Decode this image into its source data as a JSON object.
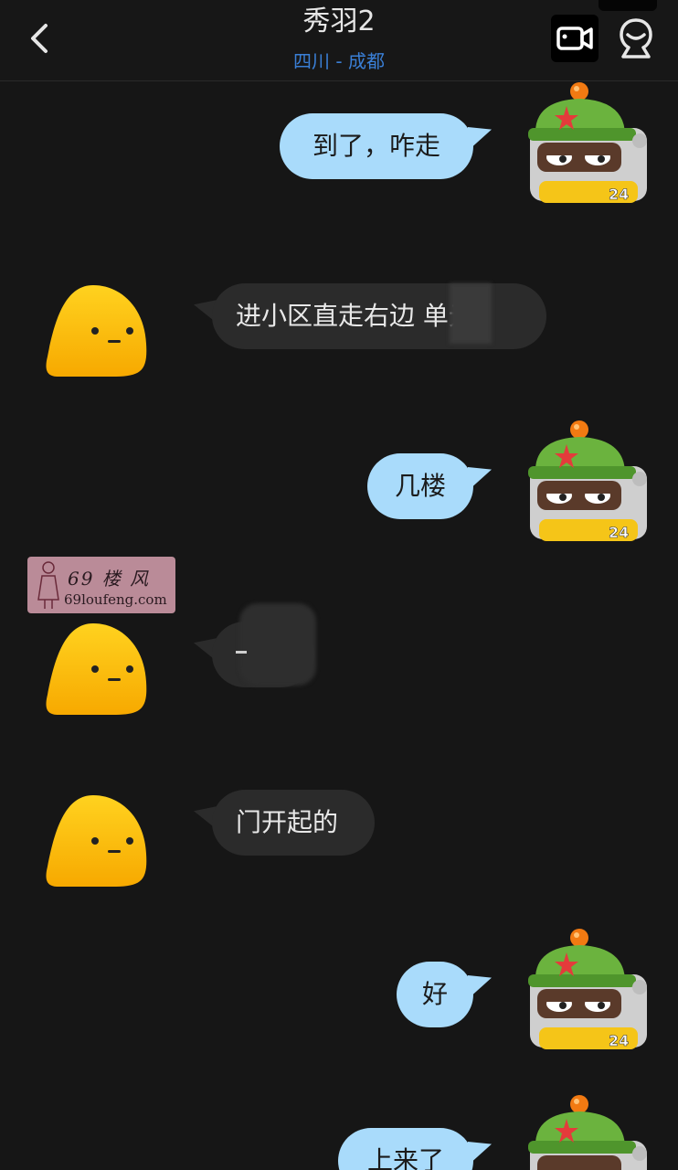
{
  "header": {
    "title": "秀羽2",
    "subtitle": "四川 - 成都",
    "back_icon": "chevron-left-icon",
    "video_icon": "video-call-icon",
    "profile_icon": "user-profile-icon"
  },
  "colors": {
    "background": "#161616",
    "outgoing_bubble": "#a9dbfb",
    "incoming_bubble": "#2b2b2b",
    "subtitle_blue": "#3a7fd6"
  },
  "messages": [
    {
      "sender": "me",
      "text": "到了，咋走"
    },
    {
      "sender": "them",
      "text": "进小区直走右边 单元"
    },
    {
      "sender": "me",
      "text": "几楼"
    },
    {
      "sender": "them",
      "text": ""
    },
    {
      "sender": "them",
      "text": "门开起的"
    },
    {
      "sender": "me",
      "text": "好"
    },
    {
      "sender": "me",
      "text": "上来了"
    }
  ],
  "robot_badge": "24",
  "watermark": {
    "line1": "69 楼 风",
    "line2": "69loufeng.com"
  }
}
